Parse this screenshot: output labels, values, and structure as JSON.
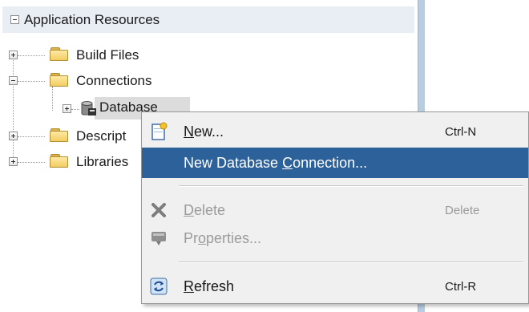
{
  "panel": {
    "header_title": "Application Resources"
  },
  "tree": {
    "build_files": "Build Files",
    "connections": "Connections",
    "database": "Database",
    "descriptors": "Descript",
    "libraries": "Libraries"
  },
  "context_menu": {
    "new": {
      "pre": "",
      "mnemonic": "N",
      "post": "ew...",
      "shortcut": "Ctrl-N",
      "icon": "new-item-icon"
    },
    "new_db_connection": {
      "pre": "New Database ",
      "mnemonic": "C",
      "post": "onnection...",
      "icon": "none"
    },
    "delete": {
      "pre": "",
      "mnemonic": "D",
      "post": "elete",
      "shortcut": "Delete",
      "icon": "delete-x-icon"
    },
    "properties": {
      "pre": "Pr",
      "mnemonic": "o",
      "post": "perties...",
      "icon": "properties-icon"
    },
    "refresh": {
      "pre": "",
      "mnemonic": "R",
      "post": "efresh",
      "shortcut": "Ctrl-R",
      "icon": "refresh-icon"
    }
  },
  "colors": {
    "highlight": "#2d6199",
    "header_bg": "#e9eef4",
    "menu_bg": "#f0f0f0",
    "disabled_text": "#9b9b9b"
  }
}
